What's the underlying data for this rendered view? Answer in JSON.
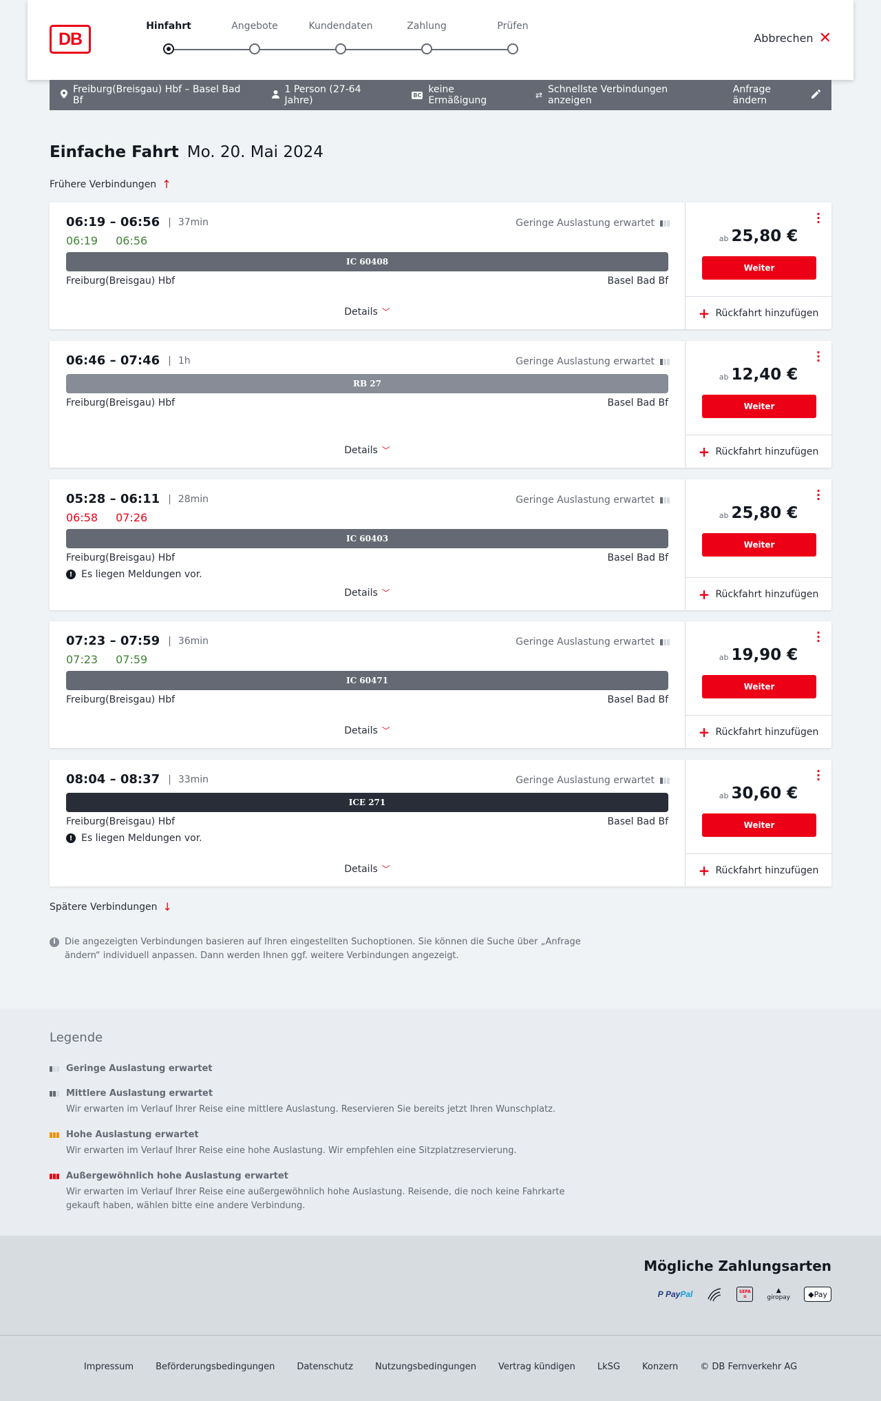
{
  "header": {
    "logo": "DB",
    "steps": [
      {
        "label": "Hinfahrt",
        "active": true
      },
      {
        "label": "Angebote",
        "active": false
      },
      {
        "label": "Kundendaten",
        "active": false
      },
      {
        "label": "Zahlung",
        "active": false
      },
      {
        "label": "Prüfen",
        "active": false
      }
    ],
    "cancel_label": "Abbrechen"
  },
  "summary": {
    "route": "Freiburg(Breisgau) Hbf – Basel Bad Bf",
    "travellers": "1 Person (27-64 Jahre)",
    "bc_icon": "BC",
    "discount": "keine Ermäßigung",
    "fastest": "Schnellste Verbindungen anzeigen",
    "edit": "Anfrage ändern"
  },
  "title": {
    "main": "Einfache Fahrt",
    "date": "Mo. 20. Mai 2024"
  },
  "earlier_label": "Frühere Verbindungen",
  "later_label": "Spätere Verbindungen",
  "details_label": "Details",
  "occupancy_label": "Geringe Auslastung erwartet",
  "price_prefix": "ab",
  "weiter_label": "Weiter",
  "return_label": "Rückfahrt hinzufügen",
  "notice_label": "Es liegen Meldungen vor.",
  "colors": {
    "db_red": "#ec0016",
    "ic_bar": "#646973",
    "rb_bar": "#878c96",
    "ice_bar": "#282d37",
    "realtime_green": "#408335"
  },
  "connections": [
    {
      "times": "06:19 – 06:56",
      "duration": "37min",
      "rt_dep": "06:19",
      "rt_arr": "06:56",
      "rt_state": "green",
      "train": "IC 60408",
      "from": "Freiburg(Breisgau) Hbf",
      "to": "Basel Bad Bf",
      "price": "25,80 €",
      "notice": false
    },
    {
      "times": "06:46 – 07:46",
      "duration": "1h",
      "rt_dep": "",
      "rt_arr": "",
      "rt_state": "none",
      "train": "RB 27",
      "from": "Freiburg(Breisgau) Hbf",
      "to": "Basel Bad Bf",
      "price": "12,40 €",
      "notice": false
    },
    {
      "times": "05:28 – 06:11",
      "duration": "28min",
      "rt_dep": "06:58",
      "rt_arr": "07:26",
      "rt_state": "red",
      "train": "IC 60403",
      "from": "Freiburg(Breisgau) Hbf",
      "to": "Basel Bad Bf",
      "price": "25,80 €",
      "notice": true
    },
    {
      "times": "07:23 – 07:59",
      "duration": "36min",
      "rt_dep": "07:23",
      "rt_arr": "07:59",
      "rt_state": "green",
      "train": "IC 60471",
      "from": "Freiburg(Breisgau) Hbf",
      "to": "Basel Bad Bf",
      "price": "19,90 €",
      "notice": false
    },
    {
      "times": "08:04 – 08:37",
      "duration": "33min",
      "rt_dep": "",
      "rt_arr": "",
      "rt_state": "none",
      "train": "ICE 271",
      "from": "Freiburg(Breisgau) Hbf",
      "to": "Basel Bad Bf",
      "price": "30,60 €",
      "notice": true
    }
  ],
  "info_note": "Die angezeigten Verbindungen basieren auf Ihren eingestellten Suchoptionen. Sie können die Suche über „Anfrage ändern“ individuell anpassen. Dann werden Ihnen ggf. weitere Verbindungen angezeigt.",
  "legend": {
    "title": "Legende",
    "items": [
      {
        "title": "Geringe Auslastung erwartet",
        "desc": ""
      },
      {
        "title": "Mittlere Auslastung erwartet",
        "desc": "Wir erwarten im Verlauf Ihrer Reise eine mittlere Auslastung. Reservieren Sie bereits jetzt Ihren Wunschplatz."
      },
      {
        "title": "Hohe Auslastung erwartet",
        "desc": "Wir erwarten im Verlauf Ihrer Reise eine hohe Auslastung. Wir empfehlen eine Sitzplatzreservierung."
      },
      {
        "title": "Außergewöhnlich hohe Auslastung erwartet",
        "desc": "Wir erwarten im Verlauf Ihrer Reise eine außergewöhnlich hohe Auslastung. Reisende, die noch keine Fahrkarte gekauft haben, wählen bitte eine andere Verbindung."
      }
    ]
  },
  "payment": {
    "title": "Mögliche Zahlungsarten",
    "paypal_a": "Pay",
    "paypal_b": "Pal",
    "sepa": "SEPA",
    "giropay": "giropay",
    "applepay": "Pay"
  },
  "footer": {
    "links": [
      "Impressum",
      "Beförderungsbedingungen",
      "Datenschutz",
      "Nutzungsbedingungen",
      "Vertrag kündigen",
      "LkSG",
      "Konzern",
      "© DB Fernverkehr AG"
    ]
  }
}
